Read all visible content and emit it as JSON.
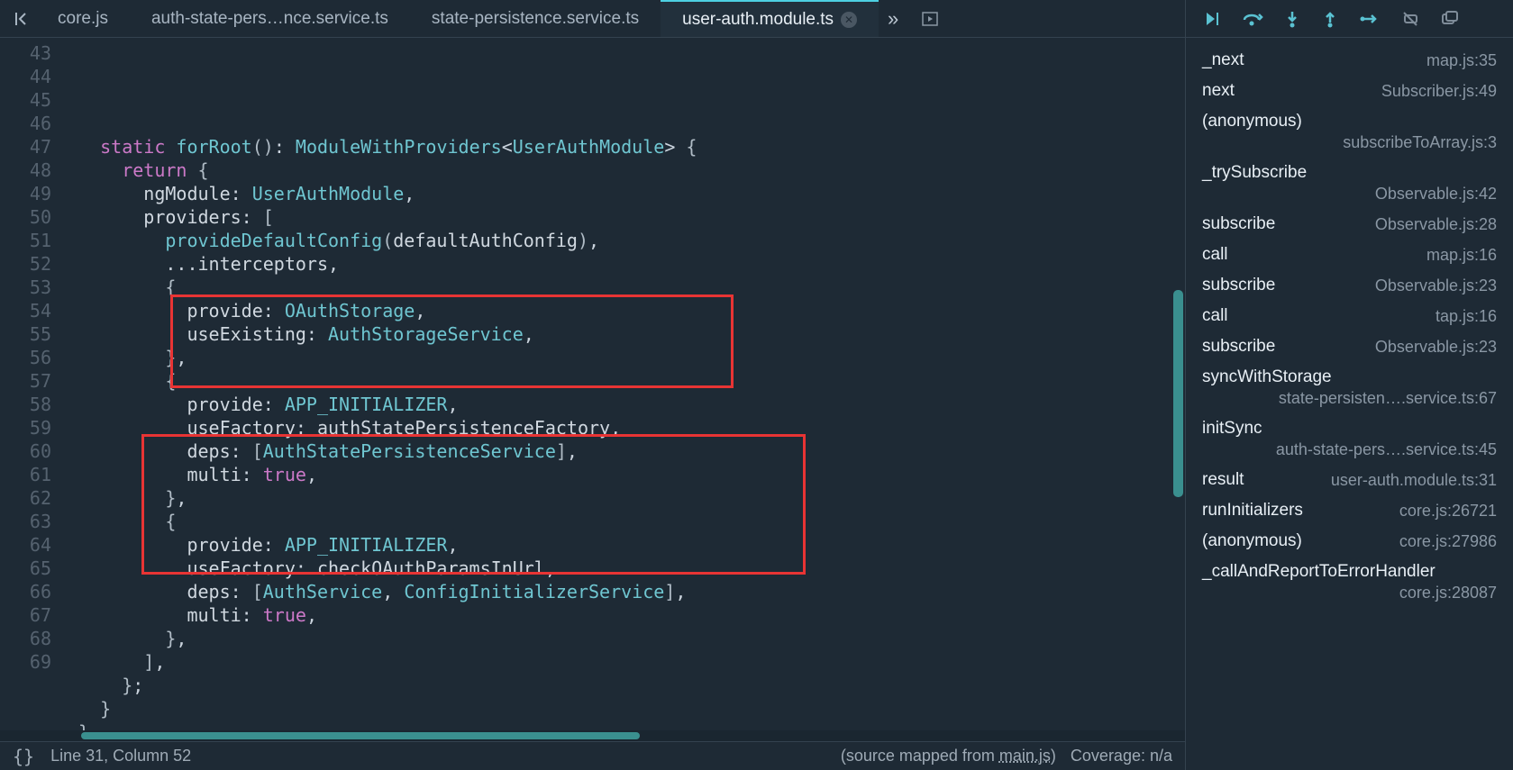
{
  "tabs": [
    {
      "label": "core.js",
      "active": false
    },
    {
      "label": "auth-state-pers…nce.service.ts",
      "active": false
    },
    {
      "label": "state-persistence.service.ts",
      "active": false
    },
    {
      "label": "user-auth.module.ts",
      "active": true
    }
  ],
  "code_lines": [
    {
      "num": 43,
      "indent": 1,
      "html": "<span class='tok-kw'>static</span> <span class='tok-fn'>forRoot</span><span class='tok-paren'>()</span>: <span class='tok-type'>ModuleWithProviders</span>&lt;<span class='tok-type'>UserAuthModule</span>&gt; <span class='tok-punct'>{</span>"
    },
    {
      "num": 44,
      "indent": 2,
      "html": "<span class='tok-kw'>return</span> <span class='tok-punct'>{</span>"
    },
    {
      "num": 45,
      "indent": 3,
      "html": "<span class='tok-prop'>ngModule</span>: <span class='tok-type'>UserAuthModule</span>,"
    },
    {
      "num": 46,
      "indent": 3,
      "html": "<span class='tok-prop'>providers</span>: <span class='tok-punct'>[</span>"
    },
    {
      "num": 47,
      "indent": 4,
      "html": "<span class='tok-fn'>provideDefaultConfig</span><span class='tok-paren'>(</span><span class='tok-prop'>defaultAuthConfig</span><span class='tok-paren'>)</span>,"
    },
    {
      "num": 48,
      "indent": 4,
      "html": "...<span class='tok-prop'>interceptors</span>,"
    },
    {
      "num": 49,
      "indent": 4,
      "html": "<span class='tok-punct'>{</span>"
    },
    {
      "num": 50,
      "indent": 5,
      "html": "<span class='tok-prop'>provide</span>: <span class='tok-type'>OAuthStorage</span>,"
    },
    {
      "num": 51,
      "indent": 5,
      "html": "<span class='tok-prop'>useExisting</span>: <span class='tok-type'>AuthStorageService</span>,"
    },
    {
      "num": 52,
      "indent": 4,
      "html": "<span class='tok-punct'>}</span>,"
    },
    {
      "num": 53,
      "indent": 4,
      "html": "<span class='tok-punct'>{</span>"
    },
    {
      "num": 54,
      "indent": 5,
      "html": "<span class='tok-prop'>provide</span>: <span class='tok-type'>APP_INITIALIZER</span>,"
    },
    {
      "num": 55,
      "indent": 5,
      "html": "<span class='tok-prop'>useFactory</span>: <span class='tok-prop'>authStatePersistenceFactory</span>,"
    },
    {
      "num": 56,
      "indent": 5,
      "html": "<span class='tok-prop'>deps</span>: <span class='tok-punct'>[</span><span class='tok-type'>AuthStatePersistenceService</span><span class='tok-punct'>]</span>,"
    },
    {
      "num": 57,
      "indent": 5,
      "html": "<span class='tok-prop'>multi</span>: <span class='tok-bool'>true</span>,"
    },
    {
      "num": 58,
      "indent": 4,
      "html": "<span class='tok-punct'>}</span>,"
    },
    {
      "num": 59,
      "indent": 4,
      "html": "<span class='tok-punct'>{</span>"
    },
    {
      "num": 60,
      "indent": 5,
      "html": "<span class='tok-prop'>provide</span>: <span class='tok-type'>APP_INITIALIZER</span>,"
    },
    {
      "num": 61,
      "indent": 5,
      "html": "<span class='tok-prop'>useFactory</span>: <span class='tok-prop'>checkOAuthParamsInUrl</span>,"
    },
    {
      "num": 62,
      "indent": 5,
      "html": "<span class='tok-prop'>deps</span>: <span class='tok-punct'>[</span><span class='tok-type'>AuthService</span>, <span class='tok-type'>ConfigInitializerService</span><span class='tok-punct'>]</span>,"
    },
    {
      "num": 63,
      "indent": 5,
      "html": "<span class='tok-prop'>multi</span>: <span class='tok-bool'>true</span>,"
    },
    {
      "num": 64,
      "indent": 4,
      "html": "<span class='tok-punct'>}</span>,"
    },
    {
      "num": 65,
      "indent": 3,
      "html": "<span class='tok-punct'>]</span>,"
    },
    {
      "num": 66,
      "indent": 2,
      "html": "<span class='tok-punct'>}</span>;"
    },
    {
      "num": 67,
      "indent": 1,
      "html": "<span class='tok-punct'>}</span>"
    },
    {
      "num": 68,
      "indent": 0,
      "html": "<span class='tok-punct'>}</span>"
    },
    {
      "num": 69,
      "indent": 0,
      "html": ""
    }
  ],
  "status": {
    "braces_icon": "{}",
    "position": "Line 31, Column 52",
    "mapped": "(source mapped from ",
    "mapped_file": "main.js",
    "mapped_close": ")",
    "coverage": "Coverage: n/a"
  },
  "debug_toolbar_icons": [
    "resume",
    "step-over",
    "step-into",
    "step-out",
    "step",
    "deactivate",
    "more"
  ],
  "call_stack": [
    {
      "fn": "_next",
      "loc": "map.js:35"
    },
    {
      "fn": "next",
      "loc": "Subscriber.js:49"
    },
    {
      "fn": "(anonymous)",
      "loc": "subscribeToArray.js:3",
      "wrap": true
    },
    {
      "fn": "_trySubscribe",
      "loc": "Observable.js:42",
      "wrap": true
    },
    {
      "fn": "subscribe",
      "loc": "Observable.js:28"
    },
    {
      "fn": "call",
      "loc": "map.js:16"
    },
    {
      "fn": "subscribe",
      "loc": "Observable.js:23"
    },
    {
      "fn": "call",
      "loc": "tap.js:16"
    },
    {
      "fn": "subscribe",
      "loc": "Observable.js:23"
    },
    {
      "fn": "syncWithStorage",
      "loc": "state-persisten….service.ts:67",
      "wrap": true
    },
    {
      "fn": "initSync",
      "loc": "auth-state-pers….service.ts:45",
      "wrap": true
    },
    {
      "fn": "result",
      "loc": "user-auth.module.ts:31"
    },
    {
      "fn": "runInitializers",
      "loc": "core.js:26721"
    },
    {
      "fn": "(anonymous)",
      "loc": "core.js:27986"
    },
    {
      "fn": "_callAndReportToErrorHandler",
      "loc": "core.js:28087",
      "wrap": true
    }
  ]
}
